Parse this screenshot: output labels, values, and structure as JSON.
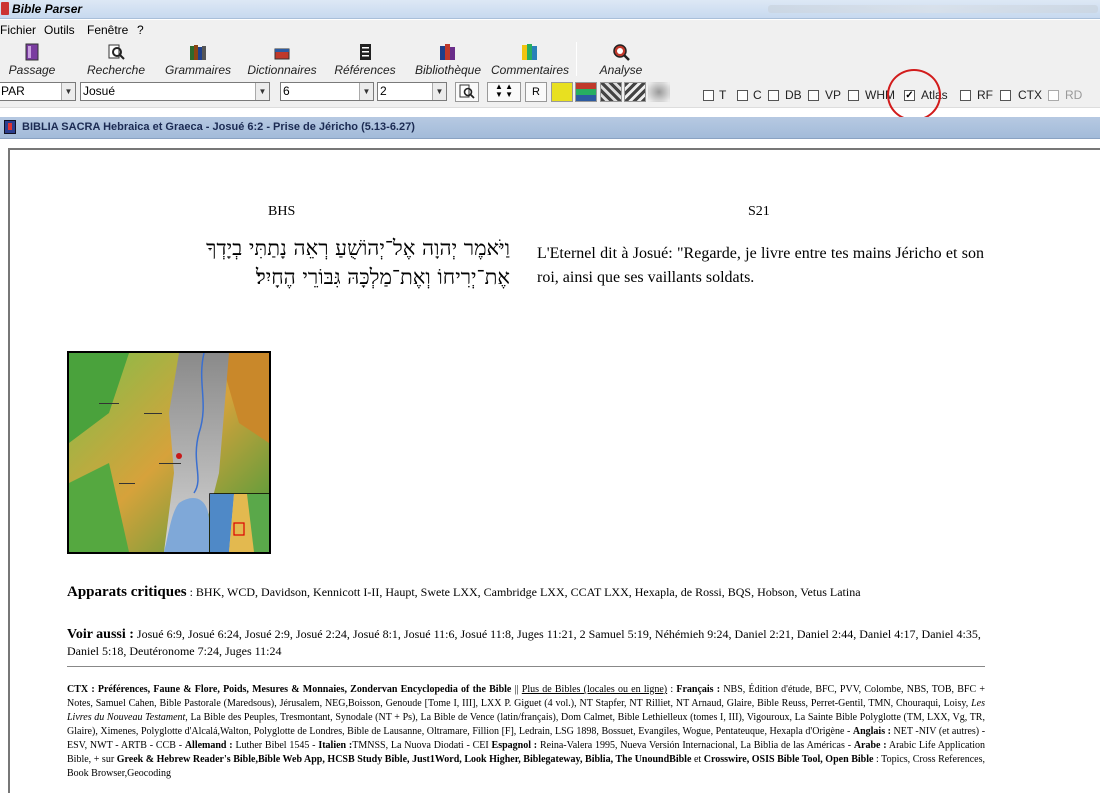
{
  "window": {
    "title": "Bible Parser"
  },
  "menu": [
    "Fichier",
    "Outils",
    "Fenêtre",
    "?"
  ],
  "toolbar": {
    "buttons": [
      {
        "label": "Passage",
        "icon": "book-icon"
      },
      {
        "label": "Recherche",
        "icon": "search-icon"
      },
      {
        "label": "Grammaires",
        "icon": "books-icon"
      },
      {
        "label": "Dictionnaires",
        "icon": "dictionary-icon"
      },
      {
        "label": "Références",
        "icon": "references-icon"
      },
      {
        "label": "Bibliothèque",
        "icon": "library-icon"
      },
      {
        "label": "Commentaires",
        "icon": "commentary-icon"
      },
      {
        "label": "Analyse",
        "icon": "analyse-icon"
      }
    ]
  },
  "controls": {
    "version": "PAR",
    "book": "Josué",
    "chapter": "6",
    "verse": "2",
    "r_button": "R",
    "checkboxes": [
      {
        "label": "T",
        "checked": false
      },
      {
        "label": "C",
        "checked": false
      },
      {
        "label": "DB",
        "checked": false
      },
      {
        "label": "VP",
        "checked": false
      },
      {
        "label": "WHM",
        "checked": false
      },
      {
        "label": "Atlas",
        "checked": true
      },
      {
        "label": "RF",
        "checked": false
      },
      {
        "label": "CTX",
        "checked": false
      },
      {
        "label": "RD",
        "checked": false
      }
    ],
    "checkmark": "✓"
  },
  "document": {
    "title": "BIBLIA SACRA Hebraica et Graeca - Josué 6:2 - Prise de Jéricho (5.13-6.27)",
    "left_header": "BHS",
    "right_header": "S21",
    "hebrew_line1": "וַיֹּאמֶר יְהוָה אֶל־יְהוֹשֻׁעַ רְאֵה נָתַתִּי בְיָדְךָ",
    "hebrew_line2": "אֶת־יְרִיחוֹ וְאֶת־מַלְכָּהּ גִּבּוֹרֵי הֶחָיִל׃",
    "french": "L'Eternel dit à Josué: \"Regarde, je livre entre tes mains Jéricho et son roi, ainsi que ses vaillants soldats.",
    "apparats_label": "Apparats critiques",
    "apparats_text": " : BHK, WCD, Davidson, Kennicott I-II, Haupt, Swete LXX, Cambridge LXX, CCAT LXX, Hexapla, de Rossi, BQS, Hobson, Vetus Latina",
    "voir_label": "Voir aussi :",
    "voir_text": " Josué 6:9, Josué 6:24, Josué 2:9, Josué 2:24, Josué 8:1, Josué 11:6, Josué 11:8, Juges 11:21, 2 Samuel 5:19, Néhémieh 9:24, Daniel 2:21, Daniel 2:44, Daniel 4:17, Daniel 4:35, Daniel 5:18, Deutéronome 7:24, Juges 11:24",
    "ctx": {
      "p1b": "CTX : Préférences, Faune & Flore, Poids, Mesures & Monnaies, Zondervan Encyclopedia of the Bible",
      "p2": " || ",
      "p3u": "Plus de Bibles (locales ou en ligne)",
      "p4": " : ",
      "p5b": "Français :",
      "p6": " NBS, Édition d'étude, BFC, PVV, Colombe, NBS, TOB, BFC + Notes, Samuel Cahen, Bible Pastorale (Maredsous), Jérusalem, NEG,Boisson, Genoude [Tome I, III], LXX P. Giguet (4 vol.), NT Stapfer, NT Rilliet, NT Arnaud, Glaire, Bible Reuss, Perret-Gentil, TMN, Chouraqui, Loisy, ",
      "p7i": "Les Livres du Nouveau Testament",
      "p8": ", La Bible des Peuples, Tresmontant, Synodale (NT + Ps), La Bible de Vence (latin/français), Dom Calmet, Bible Lethielleux (tomes I, III), Vigouroux, La Sainte Bible Polyglotte (TM, LXX, Vg, TR, Glaire), Ximenes, Polyglotte d'Alcalá,Walton, Polyglotte de Londres, Bible de Lausanne, Oltramare, Fillion [F], Ledrain, LSG 1898, Bossuet, Evangiles, Wogue, Pentateuque, Hexapla d'Origène - ",
      "p9b": "Anglais :",
      "p10": " NET -NIV (et autres) - ESV, NWT - ARTB - CCB - ",
      "p11b": "Allemand :",
      "p12": " Luther Bibel 1545 - ",
      "p13b": "Italien :",
      "p14": "TMNSS, La Nuova Diodati - CEI ",
      "p15b": "Espagnol :",
      "p16": " Reina-Valera 1995, Nueva Versión Internacional, La Biblia de las Américas - ",
      "p17b": "Arabe :",
      "p18": " Arabic Life Application Bible, + sur ",
      "p19b": "Greek & Hebrew Reader's Bible,Bible Web App, HCSB Study Bible, Just1Word, Look Higher, Biblegateway, Biblia, The UnoundBible",
      "p20": " et ",
      "p21b": "Crosswire, OSIS Bible Tool, Open Bible",
      "p22": " : Topics, Cross References, Book Browser,Geocoding"
    }
  }
}
